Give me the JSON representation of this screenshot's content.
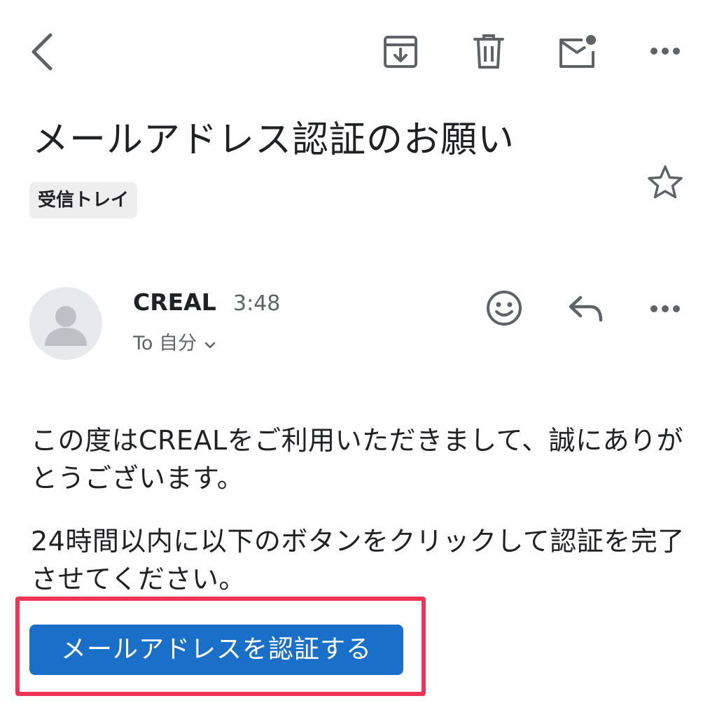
{
  "toolbar": {
    "back_icon": "chevron-left-icon",
    "archive_icon": "archive-icon",
    "delete_icon": "trash-icon",
    "mark_unread_icon": "mail-unread-icon",
    "more_icon": "more-horizontal-icon"
  },
  "email": {
    "subject": "メールアドレス認証のお願い",
    "label": "受信トレイ",
    "starred": false,
    "sender": {
      "name": "CREAL",
      "time": "3:48",
      "recipient": "To 自分"
    },
    "body": {
      "paragraph1": "この度はCREALをご利用いただきまして、誠にありがとうございます。",
      "paragraph2": "24時間以内に以下のボタンをクリックして認証を完了させてください。"
    },
    "verify_button": "メールアドレスを認証する"
  },
  "colors": {
    "button_bg": "#1a6fc9",
    "highlight_border": "#ef3555",
    "icon_gray": "#5f6368"
  }
}
